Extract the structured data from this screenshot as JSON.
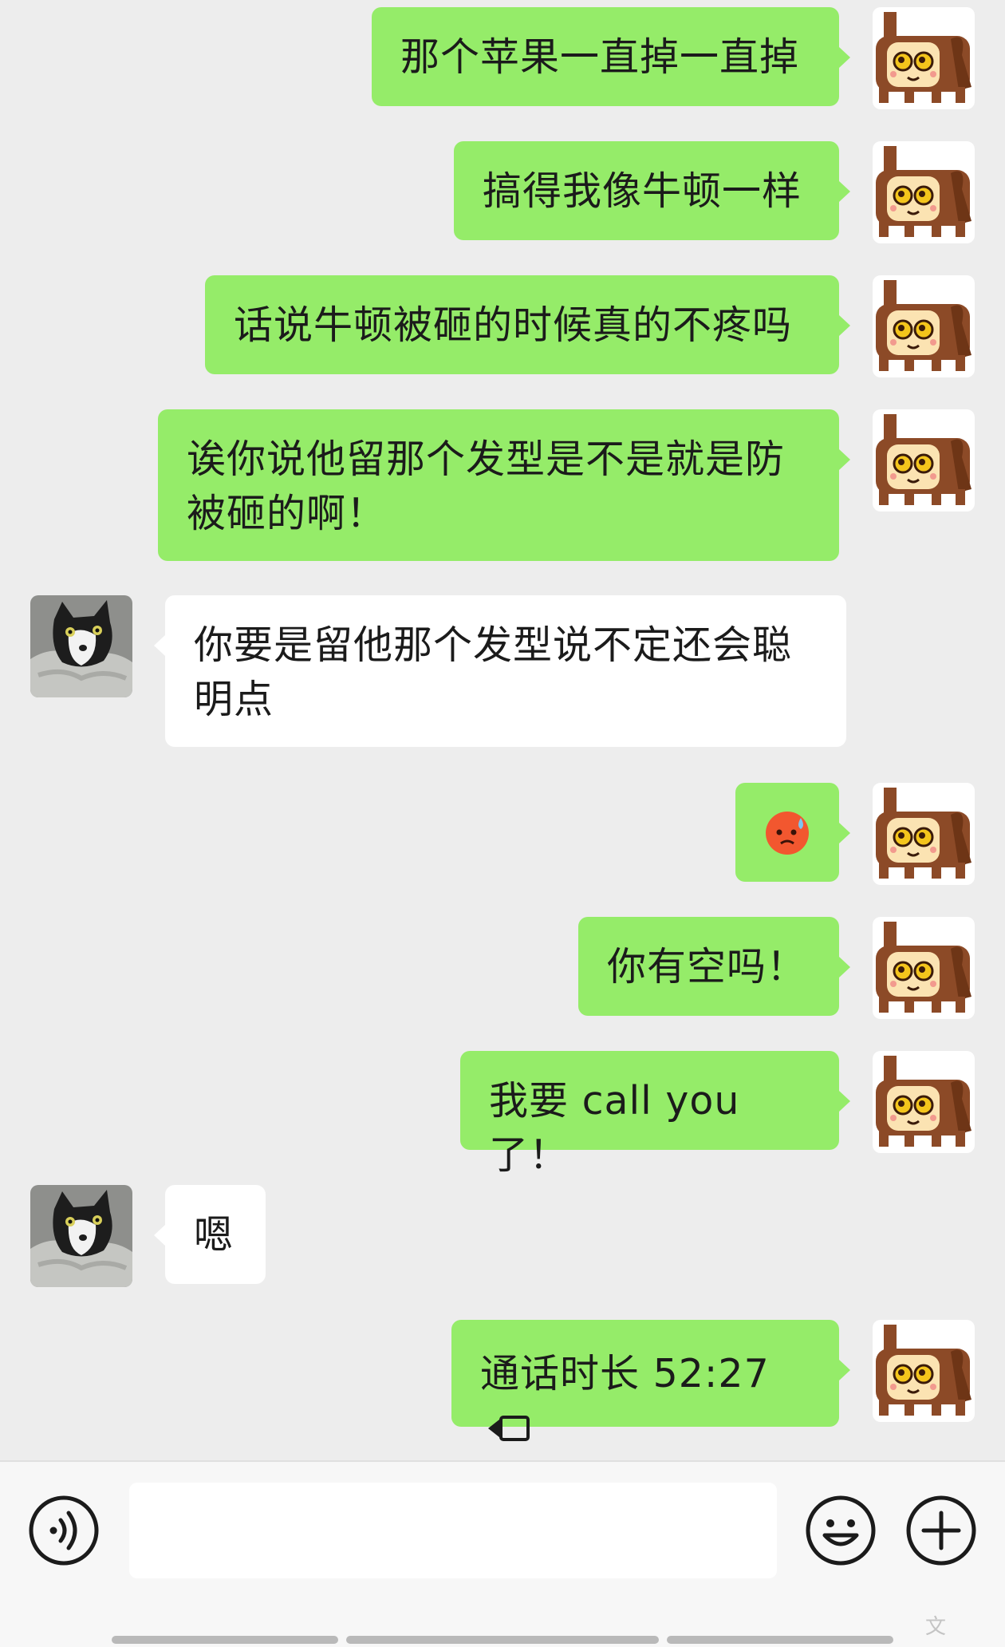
{
  "messages": [
    {
      "from": "me",
      "text": "那个苹果一直掉一直掉"
    },
    {
      "from": "me",
      "text": "搞得我像牛顿一样"
    },
    {
      "from": "me",
      "text": "话说牛顿被砸的时候真的不疼吗"
    },
    {
      "from": "me",
      "line1": "诶你说他留那个发型是不是就是防",
      "line2": "被砸的啊！"
    },
    {
      "from": "them",
      "line1": "你要是留他那个发型说不定还会聪",
      "line2": "明点"
    },
    {
      "from": "me",
      "sticker": "sweat-sad-face-emoji"
    },
    {
      "from": "me",
      "text": "你有空吗！"
    },
    {
      "from": "me",
      "text": "我要 call you 了！"
    },
    {
      "from": "them",
      "text": "嗯"
    },
    {
      "from": "me",
      "call_text": "通话时长 52:27",
      "icon": "video-call-icon"
    }
  ],
  "avatars": {
    "me": "brown-cartoon-character-avatar",
    "them": "black-white-cat-avatar"
  },
  "input_bar": {
    "voice_icon": "voice-input-icon",
    "emoji_icon": "emoji-smile-icon",
    "plus_icon": "plus-icon",
    "text_value": ""
  },
  "watermark": "文",
  "colors": {
    "my_bubble": "#95ec69",
    "their_bubble": "#ffffff",
    "background": "#ededed",
    "emoji_face": "#f2572f"
  }
}
